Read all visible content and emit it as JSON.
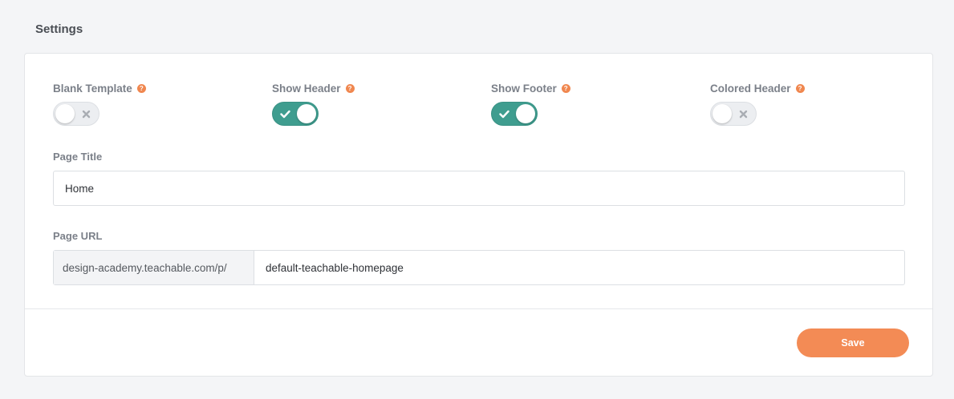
{
  "section": {
    "title": "Settings"
  },
  "toggles": [
    {
      "label": "Blank Template",
      "help": "?",
      "state": "off"
    },
    {
      "label": "Show Header",
      "help": "?",
      "state": "on"
    },
    {
      "label": "Show Footer",
      "help": "?",
      "state": "on"
    },
    {
      "label": "Colored Header",
      "help": "?",
      "state": "off"
    }
  ],
  "page_title": {
    "label": "Page Title",
    "value": "Home"
  },
  "page_url": {
    "label": "Page URL",
    "prefix": "design-academy.teachable.com/p/",
    "value": "default-teachable-homepage"
  },
  "actions": {
    "save_label": "Save"
  },
  "colors": {
    "accent": "#f38b55",
    "toggle_on": "#3f9d8f",
    "toggle_off": "#eceef1",
    "help_icon": "#f0874f"
  },
  "icons": {
    "help": "question-circle-icon",
    "on": "check-icon",
    "off": "x-icon"
  }
}
